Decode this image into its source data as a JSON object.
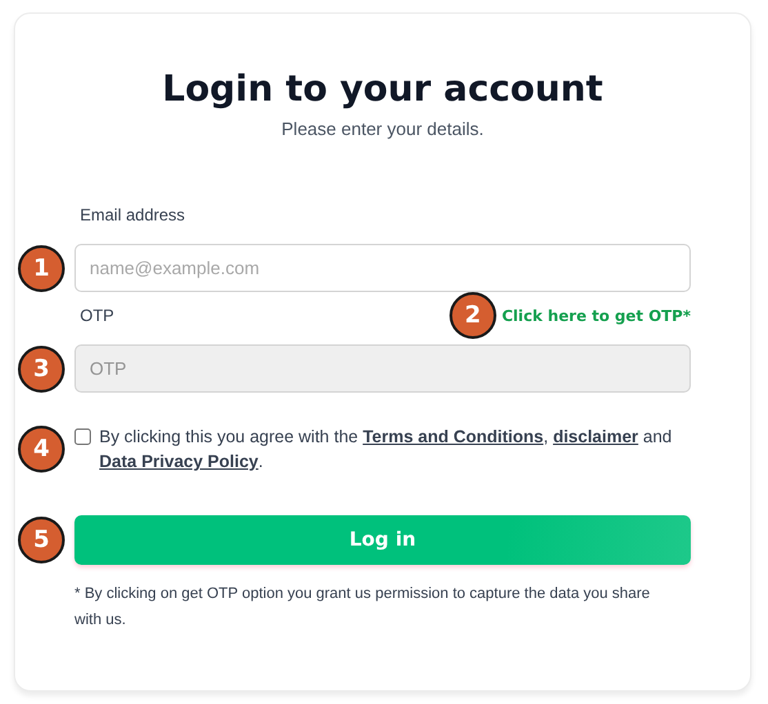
{
  "title": "Login to your account",
  "subtitle": "Please enter your details.",
  "email": {
    "label": "Email address",
    "placeholder": "name@example.com",
    "disabled": false,
    "marker": "1"
  },
  "otp": {
    "label": "OTP",
    "placeholder": "OTP",
    "disabled": true,
    "marker": "3",
    "link": "Click here to get OTP*",
    "link_marker": "2"
  },
  "agreement": {
    "checked": false,
    "marker": "4",
    "text": "By clicking this you agree with the ",
    "links": [
      {
        "text": "Terms and Conditions",
        "after": ", "
      },
      {
        "text": "disclaimer",
        "after": " and "
      },
      {
        "text": "Data Privacy Policy",
        "after": "."
      }
    ]
  },
  "login_button": {
    "label": "Log in",
    "marker": "5"
  },
  "note": " * By clicking on get OTP option you grant us permission to capture the data you share with us."
}
